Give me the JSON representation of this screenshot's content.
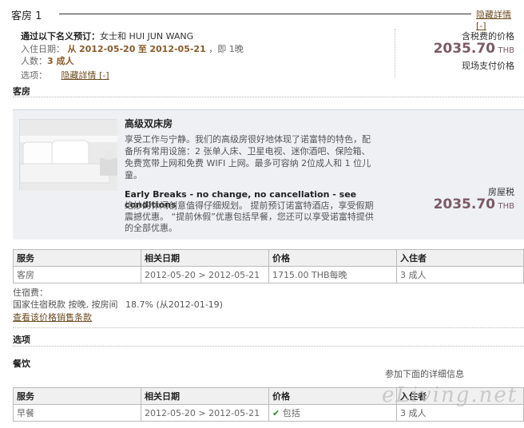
{
  "room": {
    "title": "客房 1",
    "hide_details": "隐藏詳情 [-]",
    "booked_by_label": "通过以下名义预订：",
    "guest_name": "女士和 HUI JUN WANG",
    "checkin_label": "入住日期：",
    "from_label": "从",
    "start_date": "2012-05-20",
    "to_label": "至",
    "end_date": "2012-05-21",
    "nights": "，即 1晚",
    "people_label": "人数：",
    "people_value": "3 成人",
    "options_label": "选项：",
    "options_hide": "隐藏詳情 [-]"
  },
  "summary": {
    "tax_incl_label": "含税费的价格",
    "price": "2035.70",
    "currency": "THB",
    "pay_at_hotel": "现场支付价格"
  },
  "sections": {
    "rooms": "客房",
    "options": "选项",
    "dining": "餐饮"
  },
  "offer": {
    "name": "高级双床房",
    "description": "享受工作与宁静。我们的高级房很好地体现了诺富特的特色，配备所有常用设施：2 张单人床、卫星电视、迷你酒吧、保险箱、免费宽带上网和免费 WIFI 上网。最多可容纳 2位成人和 1 位儿童。",
    "rate_name": "Early Breaks - no change, no cancellation - see conditions",
    "rate_desc": "绝妙的休闲创意值得仔细规划。 提前预订诺富特酒店，享受假期震撼优惠。 “提前休假”优惠包括早餐，您还可以享受诺富特提供的全部优惠。",
    "room_tax_label": "房屋税",
    "price": "2035.70",
    "currency": "THB"
  },
  "table1": {
    "headers": [
      "服务",
      "相关日期",
      "价格",
      "入住者"
    ],
    "row": [
      "客房",
      "2012-05-20 > 2012-05-21",
      "1715.00 THB每晚",
      "3 成人"
    ]
  },
  "tax": {
    "label": "住宿费：",
    "line": "国家住宿税款 按晚, 按房间",
    "pct": "18.7% (从2012-01-19)",
    "link": "查看该价格销售条款"
  },
  "dining_note": "参加下面的详细信息",
  "table2": {
    "headers": [
      "服务",
      "相关日期",
      "价格",
      "入住者"
    ],
    "row": [
      "早餐",
      "2012-05-20 > 2012-05-21",
      "包括",
      "3 成人"
    ]
  },
  "watermark": "eLiving.net"
}
